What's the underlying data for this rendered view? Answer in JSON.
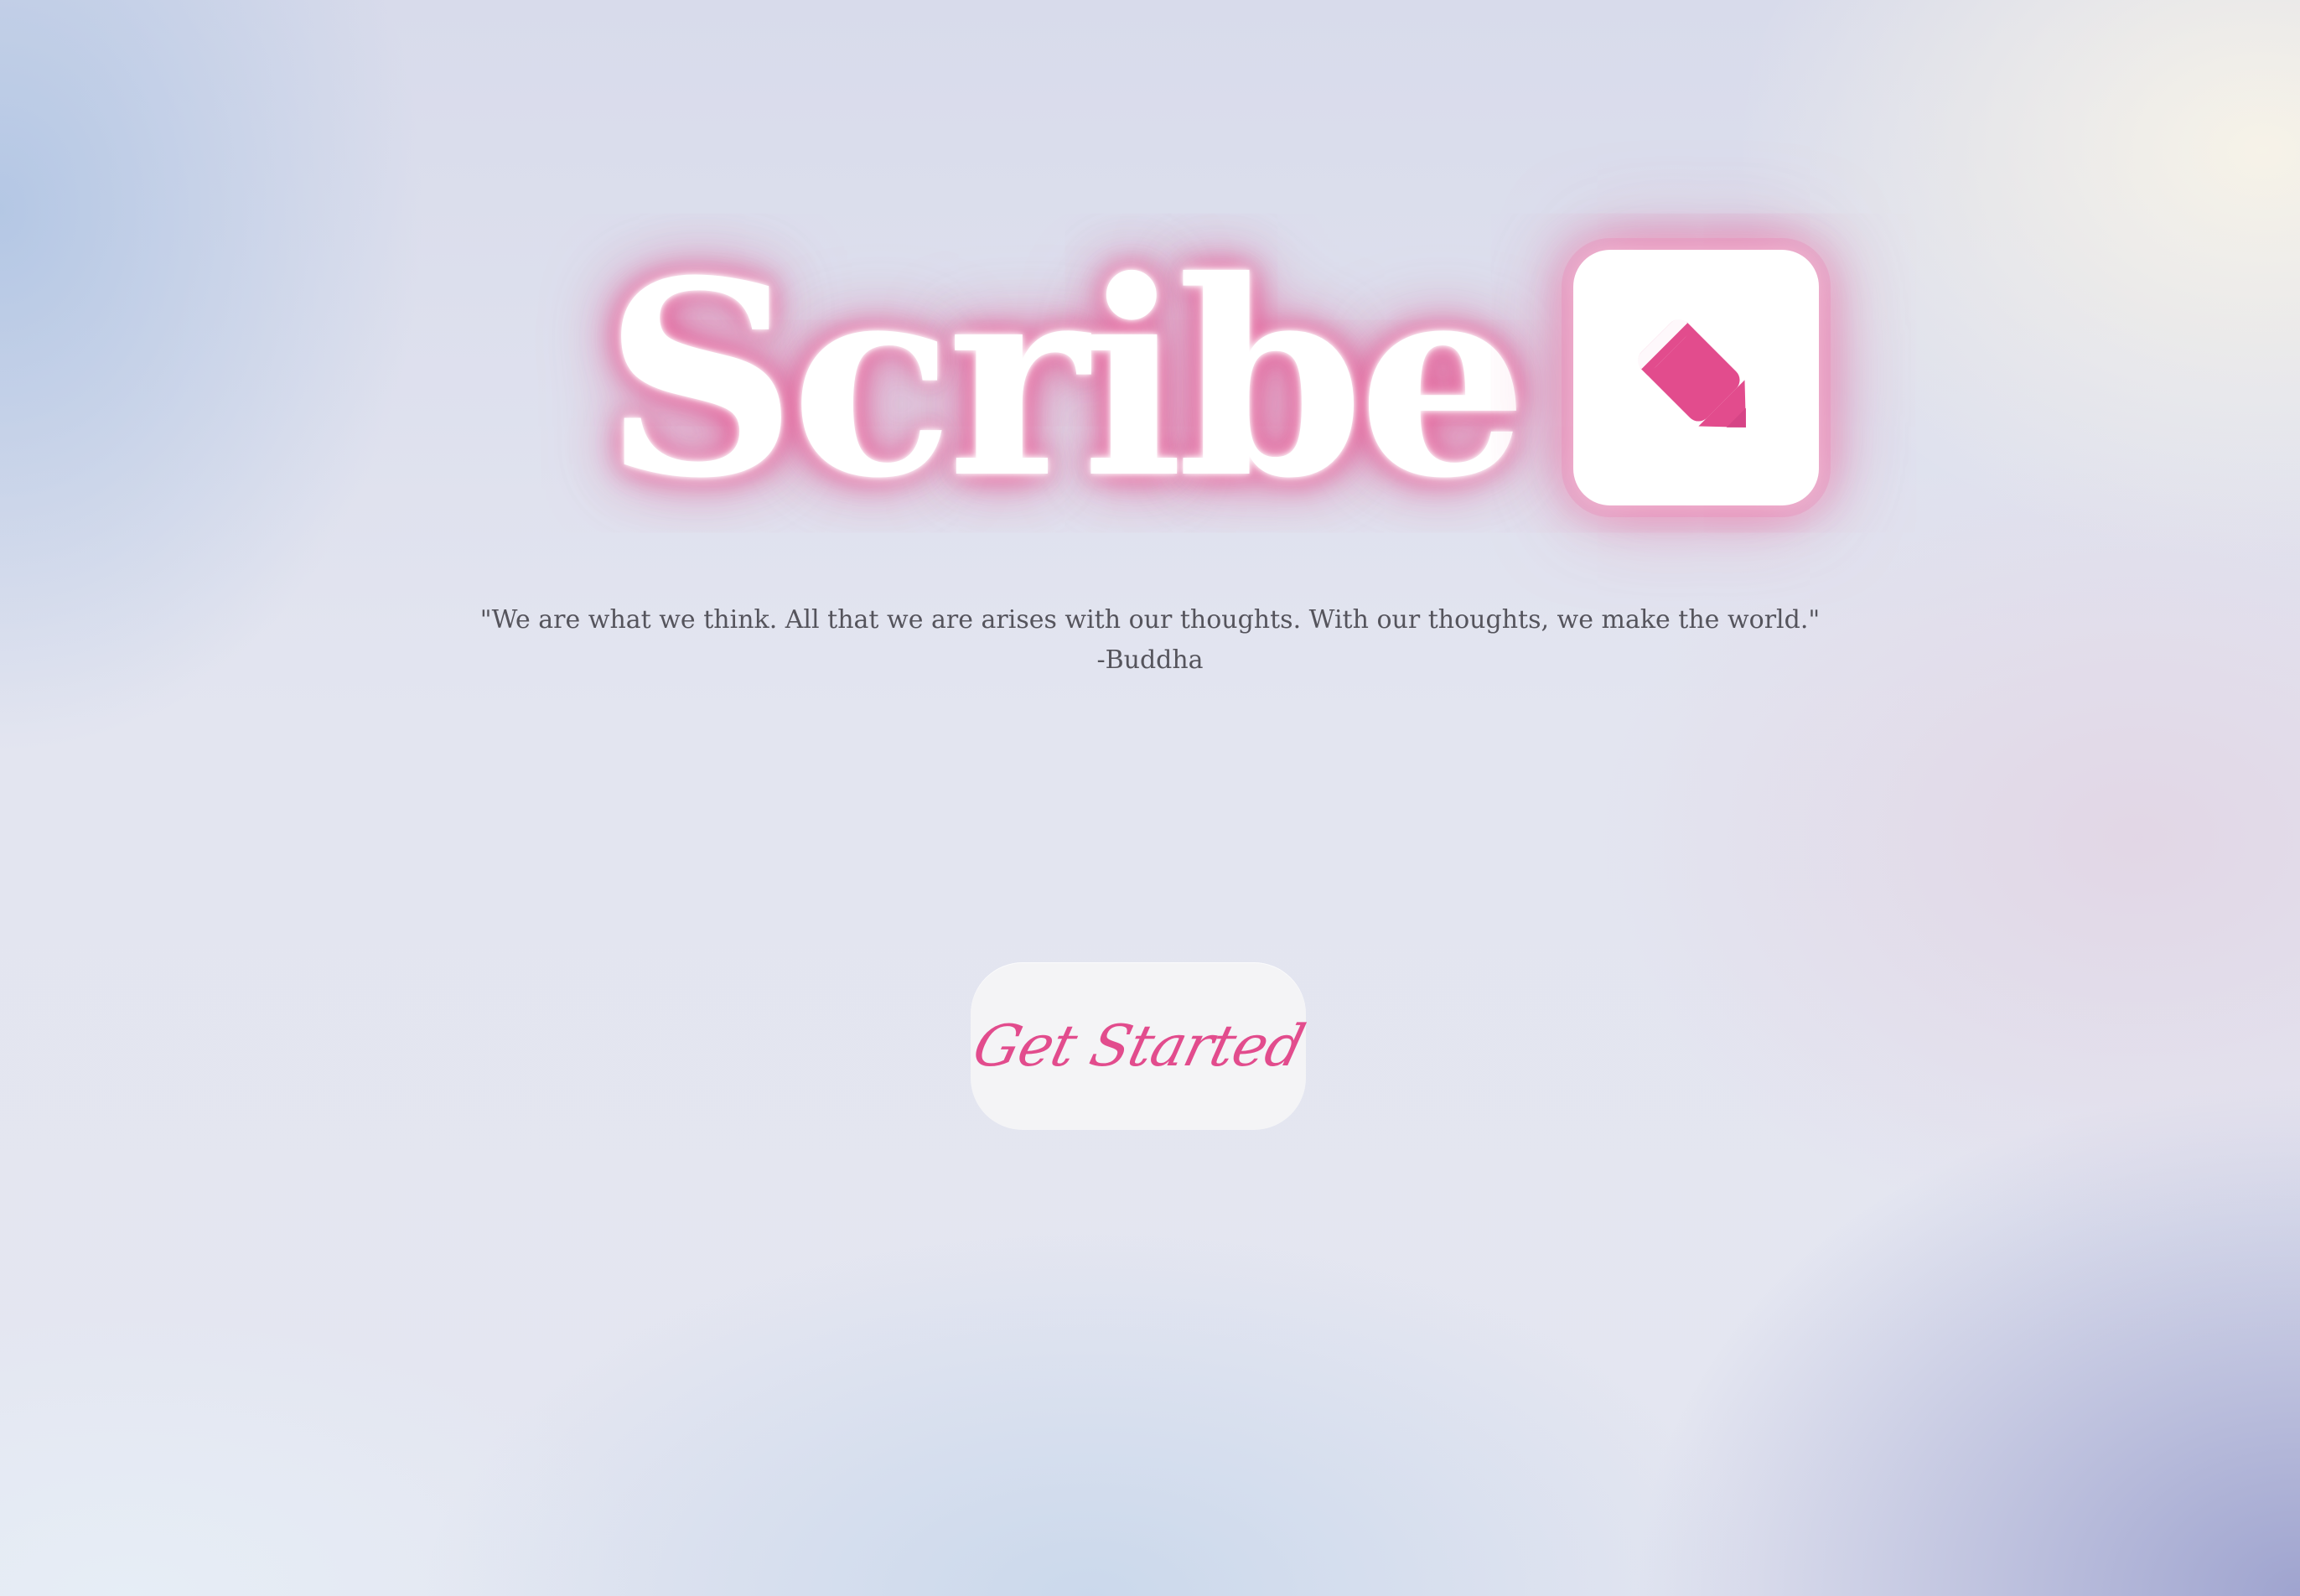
{
  "app": {
    "name": "Scribe"
  },
  "hero": {
    "quote": "\"We are what we think. All that we are arises with our thoughts. With our thoughts, we make the world.\"",
    "attribution": "-Buddha",
    "cta_label": "Get Started",
    "logo_icon": "pencil-icon"
  },
  "colors": {
    "accent": "#E24C8D",
    "text": "#55545C",
    "button_bg": "#F4F4F6"
  }
}
